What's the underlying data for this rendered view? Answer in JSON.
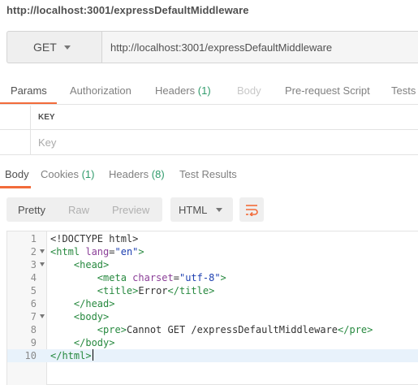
{
  "request": {
    "title": "http://localhost:3001/expressDefaultMiddleware",
    "method": "GET",
    "url": "http://localhost:3001/expressDefaultMiddleware"
  },
  "request_tabs": [
    {
      "label": "Params",
      "count": "",
      "state": "active"
    },
    {
      "label": "Authorization",
      "count": "",
      "state": "normal"
    },
    {
      "label": "Headers",
      "count": "(1)",
      "state": "normal"
    },
    {
      "label": "Body",
      "count": "",
      "state": "disabled"
    },
    {
      "label": "Pre-request Script",
      "count": "",
      "state": "normal"
    },
    {
      "label": "Tests",
      "count": "",
      "state": "normal"
    }
  ],
  "params": {
    "key_header": "KEY",
    "key_placeholder": "Key"
  },
  "response_tabs": [
    {
      "label": "Body",
      "count": "",
      "state": "active"
    },
    {
      "label": "Cookies",
      "count": "(1)",
      "state": "normal"
    },
    {
      "label": "Headers",
      "count": "(8)",
      "state": "normal"
    },
    {
      "label": "Test Results",
      "count": "",
      "state": "normal"
    }
  ],
  "view": {
    "modes": [
      "Pretty",
      "Raw",
      "Preview"
    ],
    "active_mode": "Pretty",
    "format": "HTML",
    "wrap_icon": "wrap-lines-icon"
  },
  "colors": {
    "accent": "#f26b3a",
    "count_green": "#2f9b6b"
  },
  "code": {
    "line_numbers": [
      "1",
      "2",
      "3",
      "4",
      "5",
      "6",
      "7",
      "8",
      "9",
      "10"
    ],
    "active_line": "10",
    "foldable_lines": [
      "2",
      "3",
      "7"
    ],
    "lines": [
      "<!DOCTYPE html>",
      "<html lang=\"en\">",
      "    <head>",
      "        <meta charset=\"utf-8\">",
      "        <title>Error</title>",
      "    </head>",
      "    <body>",
      "        <pre>Cannot GET /expressDefaultMiddleware</pre>",
      "    </body>",
      "</html>"
    ]
  }
}
